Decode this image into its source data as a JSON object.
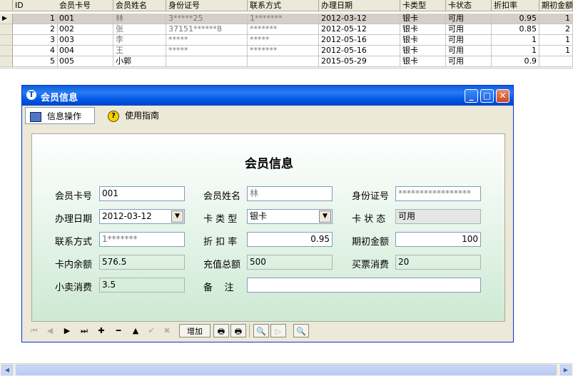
{
  "grid": {
    "columns": [
      "ID",
      "会员卡号",
      "会员姓名",
      "身份证号",
      "联系方式",
      "办理日期",
      "卡类型",
      "卡状态",
      "折扣率",
      "期初金额"
    ],
    "rows": [
      {
        "id": "1",
        "card": "001",
        "name": "林",
        "idno": "3*****25",
        "phone": "1*******",
        "date": "2012-03-12",
        "type": "银卡",
        "status": "可用",
        "discount": "0.95",
        "initial": "1"
      },
      {
        "id": "2",
        "card": "002",
        "name": "张",
        "idno": "37151******8",
        "phone": "*******",
        "date": "2012-05-12",
        "type": "银卡",
        "status": "可用",
        "discount": "0.85",
        "initial": "2"
      },
      {
        "id": "3",
        "card": "003",
        "name": "李",
        "idno": "*****",
        "phone": "*****",
        "date": "2012-05-16",
        "type": "银卡",
        "status": "可用",
        "discount": "1",
        "initial": "1"
      },
      {
        "id": "4",
        "card": "004",
        "name": "王",
        "idno": "*****",
        "phone": "*******",
        "date": "2012-05-16",
        "type": "银卡",
        "status": "可用",
        "discount": "1",
        "initial": "1"
      },
      {
        "id": "5",
        "card": "005",
        "name": "小郭",
        "idno": "",
        "phone": "",
        "date": "2015-05-29",
        "type": "银卡",
        "status": "可用",
        "discount": "0.9",
        "initial": ""
      }
    ]
  },
  "window": {
    "title": "会员信息",
    "tabs": [
      "信息操作",
      "使用指南"
    ],
    "form_title": "会员信息",
    "fields": {
      "card_no": {
        "label": "会员卡号",
        "value": "001"
      },
      "name": {
        "label": "会员姓名",
        "value": "林"
      },
      "id_no": {
        "label": "身份证号",
        "value": "*****************"
      },
      "date": {
        "label": "办理日期",
        "value": "2012-03-12"
      },
      "card_type": {
        "label": "卡 类 型",
        "value": "银卡"
      },
      "card_status": {
        "label": "卡 状 态",
        "value": "可用"
      },
      "phone": {
        "label": "联系方式",
        "value": "1*******"
      },
      "discount": {
        "label": "折 扣 率",
        "value": "0.95"
      },
      "initial": {
        "label": "期初金额",
        "value": "100"
      },
      "balance": {
        "label": "卡内余额",
        "value": "576.5"
      },
      "recharge": {
        "label": "充值总额",
        "value": "500"
      },
      "ticket": {
        "label": "买票消费",
        "value": "20"
      },
      "snack": {
        "label": "小卖消费",
        "value": "3.5"
      },
      "remark": {
        "label": "备    注",
        "value": ""
      }
    },
    "toolbar": {
      "first": "⏮",
      "prev": "◀",
      "next": "▶",
      "last": "⏭",
      "add_sym": "✚",
      "del_sym": "━",
      "up": "▲",
      "ok": "✔",
      "cancel": "✖",
      "add_label": "增加"
    }
  }
}
